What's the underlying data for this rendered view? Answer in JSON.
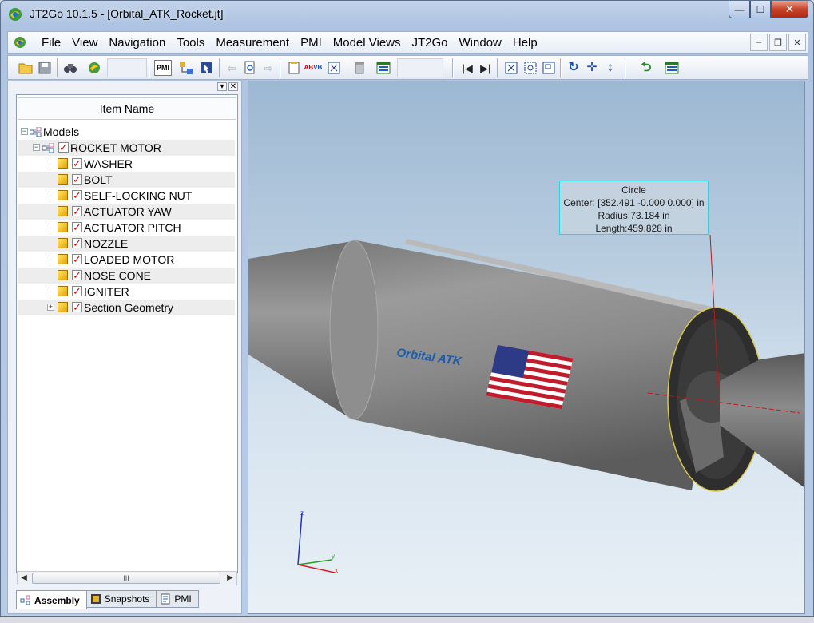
{
  "window": {
    "title": "JT2Go 10.1.5 - [Orbital_ATK_Rocket.jt]",
    "controls": {
      "minimize": "—",
      "maximize": "☐",
      "close": "✕"
    }
  },
  "menu": {
    "items": [
      "File",
      "View",
      "Navigation",
      "Tools",
      "Measurement",
      "PMI",
      "Model Views",
      "JT2Go",
      "Window",
      "Help"
    ],
    "mdi": {
      "minimize": "–",
      "restore": "❐",
      "close": "✕"
    }
  },
  "toolbar": {
    "pmi_label": "PMI"
  },
  "tree": {
    "header": "Item Name",
    "root": "Models",
    "assembly": "ROCKET MOTOR",
    "parts": [
      "WASHER",
      "BOLT",
      "SELF-LOCKING NUT",
      "ACTUATOR YAW",
      "ACTUATOR PITCH",
      "NOZZLE",
      "LOADED MOTOR",
      "NOSE CONE",
      "IGNITER",
      "Section Geometry"
    ],
    "scroll_grip": "III"
  },
  "tabs": [
    "Assembly",
    "Snapshots",
    "PMI"
  ],
  "viewport": {
    "pmi": {
      "title": "Circle",
      "center": "Center: [352.491 -0.000 0.000] in",
      "radius": "Radius:73.184 in",
      "length": "Length:459.828 in"
    },
    "logo_text": "Orbital ATK",
    "triad": {
      "x": "x",
      "y": "y",
      "z": "z"
    }
  },
  "colors": {
    "accent_check": "#dd0000",
    "pmi_border": "#25d6e0",
    "rocket_body": "#8d8d8d"
  }
}
